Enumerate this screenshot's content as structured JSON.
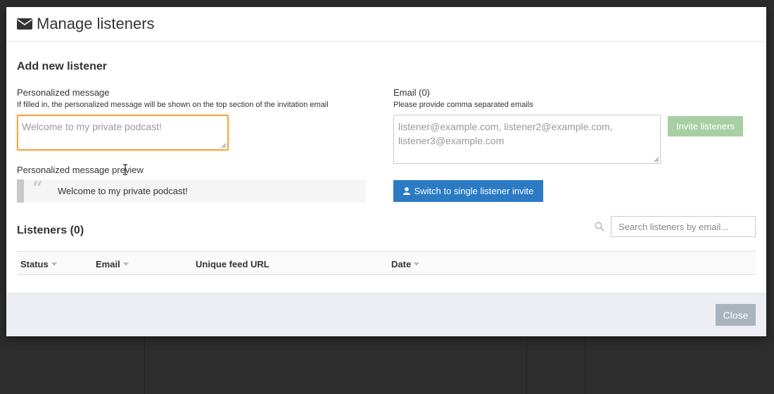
{
  "modal": {
    "title": "Manage listeners",
    "section_title": "Add new listener"
  },
  "message": {
    "label": "Personalized message",
    "help": "If filled in, the personalized message will be shown on the top section of the invitation email",
    "placeholder": "Welcome to my private podcast!"
  },
  "preview": {
    "label": "Personalized message preview",
    "text": "Welcome to my private podcast!"
  },
  "email": {
    "label": "Email (0)",
    "help": "Please provide comma separated emails",
    "placeholder": "listener@example.com, listener2@example.com, listener3@example.com"
  },
  "buttons": {
    "invite": "Invite listeners",
    "switch": "Switch to single listener invite",
    "close": "Close"
  },
  "listeners": {
    "title": "Listeners (0)",
    "search_placeholder": "Search listeners by email...",
    "columns": [
      "Status",
      "Email",
      "Unique feed URL",
      "Date"
    ]
  },
  "colors": {
    "primary": "#2a7bc4",
    "success_disabled": "#a8cfa3",
    "focus_border": "#f0a942",
    "close_button": "#a9b4bf"
  }
}
